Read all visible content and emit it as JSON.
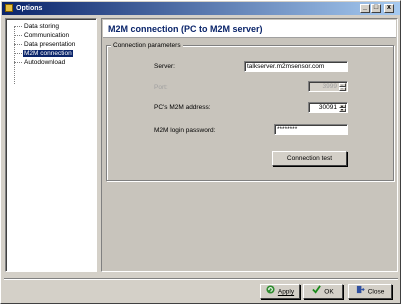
{
  "window": {
    "title": "Options"
  },
  "title_buttons": {
    "minimize": "_",
    "maximize": "□",
    "close": "x"
  },
  "tree": {
    "items": [
      {
        "label": "Data storing",
        "selected": false
      },
      {
        "label": "Communication",
        "selected": false
      },
      {
        "label": "Data presentation",
        "selected": false
      },
      {
        "label": "M2M connection",
        "selected": true
      },
      {
        "label": "Autodownload",
        "selected": false
      }
    ]
  },
  "page": {
    "title": "M2M connection (PC to M2M server)"
  },
  "connection": {
    "group_label": "Connection parameters",
    "server_label": "Server:",
    "server_value": "talkserver.m2msensor.com",
    "port_label": "Port:",
    "port_value": "3999",
    "address_label": "PC's M2M address:",
    "address_value": "30091",
    "password_label": "M2M login password:",
    "password_value": "********",
    "test_button": "Connection test"
  },
  "footer": {
    "apply": "Apply",
    "ok": "OK",
    "close": "Close"
  },
  "colors": {
    "title_bar": "#0a246a",
    "page_title_text": "#0a246a",
    "selected_item": "#0a246a"
  }
}
